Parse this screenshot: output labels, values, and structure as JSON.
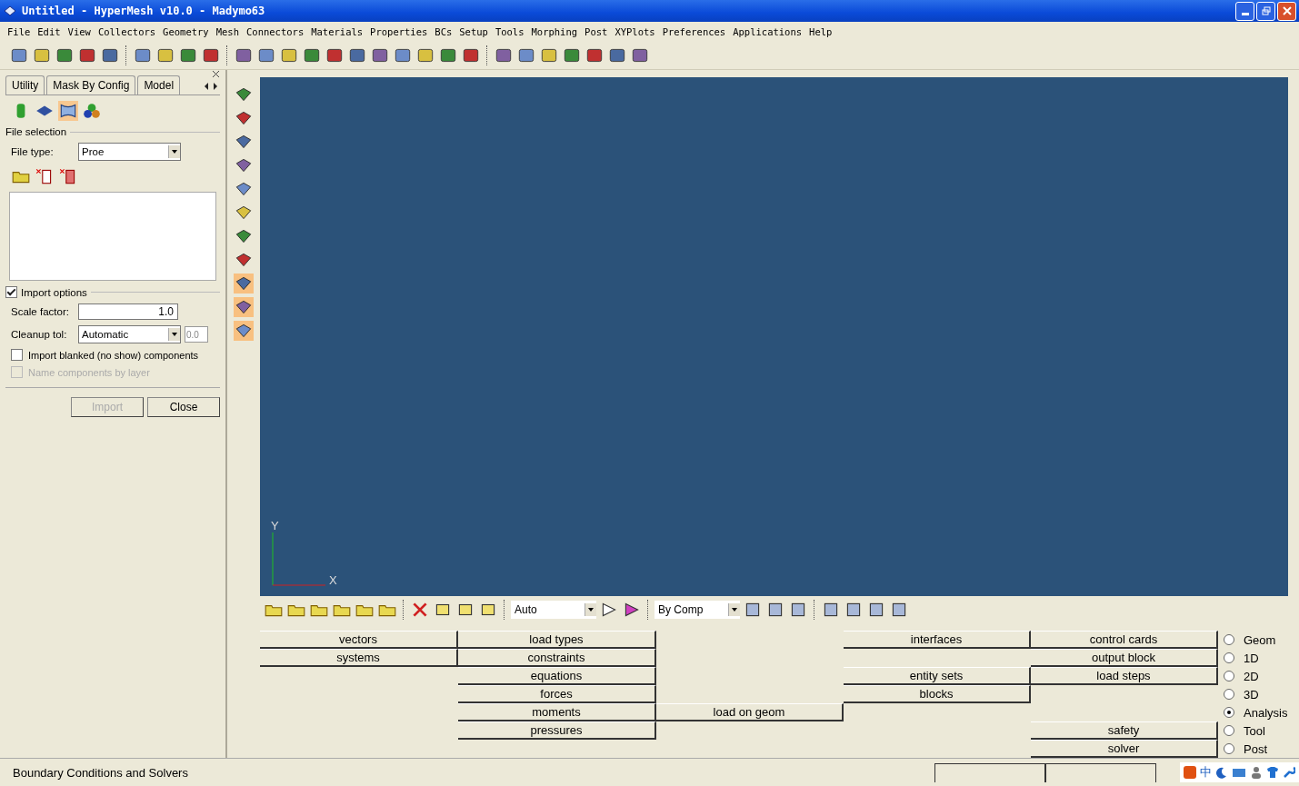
{
  "window": {
    "title": "Untitled - HyperMesh v10.0 - Madymo63"
  },
  "menu": [
    "File",
    "Edit",
    "View",
    "Collectors",
    "Geometry",
    "Mesh",
    "Connectors",
    "Materials",
    "Properties",
    "BCs",
    "Setup",
    "Tools",
    "Morphing",
    "Post",
    "XYPlots",
    "Preferences",
    "Applications",
    "Help"
  ],
  "panel": {
    "tabs": [
      {
        "label": "Utility",
        "selected": false
      },
      {
        "label": "Mask By Config",
        "selected": false
      },
      {
        "label": "Model",
        "selected": false
      }
    ],
    "file_selection": {
      "title": "File selection",
      "file_type_label": "File type:",
      "file_type": "Proe"
    },
    "import_options": {
      "title": "Import options",
      "expanded": true,
      "scale_label": "Scale factor:",
      "scale": "1.0",
      "cleanup_label": "Cleanup tol:",
      "cleanup": "Automatic",
      "cleanup_value": "0.0",
      "checkboxes": [
        {
          "label": "Import blanked (no show) components",
          "checked": false,
          "disabled": false
        },
        {
          "label": "Name components by layer",
          "checked": false,
          "disabled": true
        }
      ]
    },
    "buttons": [
      {
        "label": "Import",
        "disabled": true
      },
      {
        "label": "Close",
        "disabled": false
      }
    ]
  },
  "viewport": {
    "y_axis": "Y",
    "x_axis": "X"
  },
  "display_toolbar": {
    "mode": "Auto",
    "color_by": "By Comp"
  },
  "bc_menu": {
    "columns": [
      [
        "vectors",
        "systems"
      ],
      [
        "load types",
        "constraints",
        "equations",
        "forces",
        "moments",
        "pressures"
      ],
      [
        null,
        null,
        null,
        null,
        "load on geom"
      ],
      [
        "interfaces",
        null,
        "entity sets",
        "blocks"
      ],
      [
        "control cards",
        "output block",
        "load steps",
        null,
        null,
        "safety",
        "solver"
      ]
    ],
    "pages": [
      {
        "label": "Geom",
        "selected": false
      },
      {
        "label": "1D",
        "selected": false
      },
      {
        "label": "2D",
        "selected": false
      },
      {
        "label": "3D",
        "selected": false
      },
      {
        "label": "Analysis",
        "selected": true
      },
      {
        "label": "Tool",
        "selected": false
      },
      {
        "label": "Post",
        "selected": false
      }
    ]
  },
  "status_bar": {
    "text": "Boundary Conditions and Solvers",
    "ime": "中"
  }
}
